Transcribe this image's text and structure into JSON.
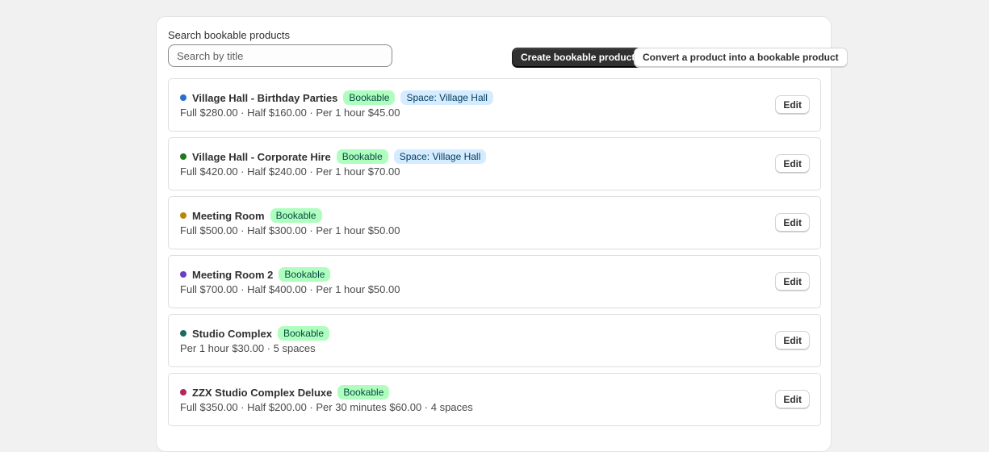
{
  "search": {
    "label": "Search bookable products",
    "placeholder": "Search by title",
    "value": ""
  },
  "actions": {
    "create_label": "Create bookable product",
    "convert_label": "Convert a product into a bookable product"
  },
  "colors": {
    "badge_bookable_bg": "#affebf",
    "badge_space_bg": "#d5ebff",
    "primary_button_bg": "#303030"
  },
  "products": [
    {
      "title": "Village Hall - Birthday Parties",
      "dot_color": "#2c6ecb",
      "badges": [
        "Bookable",
        "Space: Village Hall"
      ],
      "details": "Full $280.00 · Half $160.00 · Per 1 hour $45.00",
      "edit_label": "Edit"
    },
    {
      "title": "Village Hall - Corporate Hire",
      "dot_color": "#1f7a1f",
      "badges": [
        "Bookable",
        "Space: Village Hall"
      ],
      "details": "Full $420.00 · Half $240.00 · Per 1 hour $70.00",
      "edit_label": "Edit"
    },
    {
      "title": "Meeting Room",
      "dot_color": "#b8860b",
      "badges": [
        "Bookable"
      ],
      "details": "Full $500.00 · Half $300.00 · Per 1 hour $50.00",
      "edit_label": "Edit"
    },
    {
      "title": "Meeting Room 2",
      "dot_color": "#6b3fc4",
      "badges": [
        "Bookable"
      ],
      "details": "Full $700.00 · Half $400.00 · Per 1 hour $50.00",
      "edit_label": "Edit"
    },
    {
      "title": "Studio Complex",
      "dot_color": "#1b6b5a",
      "badges": [
        "Bookable"
      ],
      "details": "Per 1 hour $30.00 · 5 spaces",
      "edit_label": "Edit"
    },
    {
      "title": "ZZX Studio Complex Deluxe",
      "dot_color": "#b5275e",
      "badges": [
        "Bookable"
      ],
      "details": "Full $350.00 · Half $200.00 · Per 30 minutes $60.00 · 4 spaces",
      "edit_label": "Edit"
    }
  ]
}
